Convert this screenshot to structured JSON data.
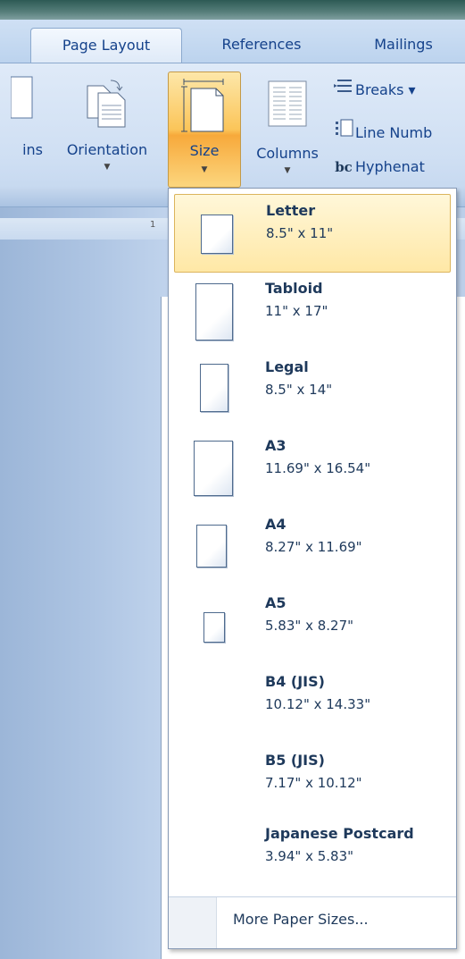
{
  "ribbon_tabs": {
    "page_layout": "Page Layout",
    "references": "References",
    "mailings": "Mailings"
  },
  "ribbon": {
    "margins_label": "ins",
    "orientation_label": "Orientation",
    "size_label": "Size",
    "columns_label": "Columns",
    "breaks_label": "Breaks ▾",
    "line_numbers_label": "Line Numb",
    "hyphenation_label": "Hyphenat",
    "hyphenation_icon_text": "bc"
  },
  "ruler": {
    "mark": "1"
  },
  "size_menu": {
    "selected": "Letter",
    "items": [
      {
        "name": "Letter",
        "dims": "8.5\" x 11\""
      },
      {
        "name": "Tabloid",
        "dims": "11\" x 17\""
      },
      {
        "name": "Legal",
        "dims": "8.5\" x 14\""
      },
      {
        "name": "A3",
        "dims": "11.69\" x 16.54\""
      },
      {
        "name": "A4",
        "dims": "8.27\" x 11.69\""
      },
      {
        "name": "A5",
        "dims": "5.83\" x 8.27\""
      },
      {
        "name": "B4 (JIS)",
        "dims": "10.12\" x 14.33\""
      },
      {
        "name": "B5 (JIS)",
        "dims": "7.17\" x 10.12\""
      },
      {
        "name": "Japanese Postcard",
        "dims": "3.94\" x 5.83\""
      }
    ],
    "more_label": "More Paper Sizes..."
  },
  "colors": {
    "ribbon_text": "#15428b",
    "menu_text": "#1e395b",
    "highlight": "#fbc559"
  }
}
